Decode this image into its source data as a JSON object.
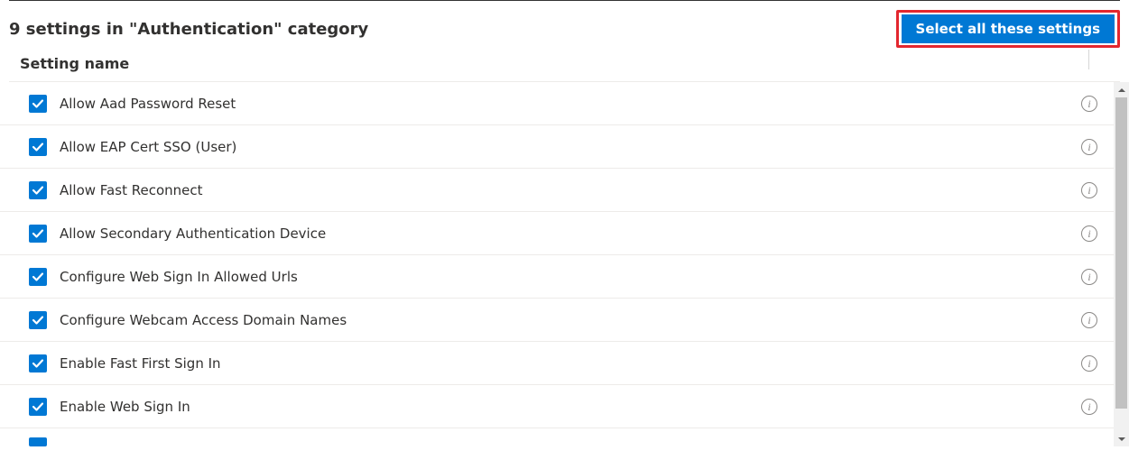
{
  "header": {
    "category_title": "9 settings in \"Authentication\" category",
    "select_all_label": "Select all these settings"
  },
  "table": {
    "column_header": "Setting name"
  },
  "settings": [
    {
      "label": "Allow Aad Password Reset",
      "checked": true
    },
    {
      "label": "Allow EAP Cert SSO (User)",
      "checked": true
    },
    {
      "label": "Allow Fast Reconnect",
      "checked": true
    },
    {
      "label": "Allow Secondary Authentication Device",
      "checked": true
    },
    {
      "label": "Configure Web Sign In Allowed Urls",
      "checked": true
    },
    {
      "label": "Configure Webcam Access Domain Names",
      "checked": true
    },
    {
      "label": "Enable Fast First Sign In",
      "checked": true
    },
    {
      "label": "Enable Web Sign In",
      "checked": true
    }
  ],
  "icons": {
    "info_glyph": "i"
  }
}
